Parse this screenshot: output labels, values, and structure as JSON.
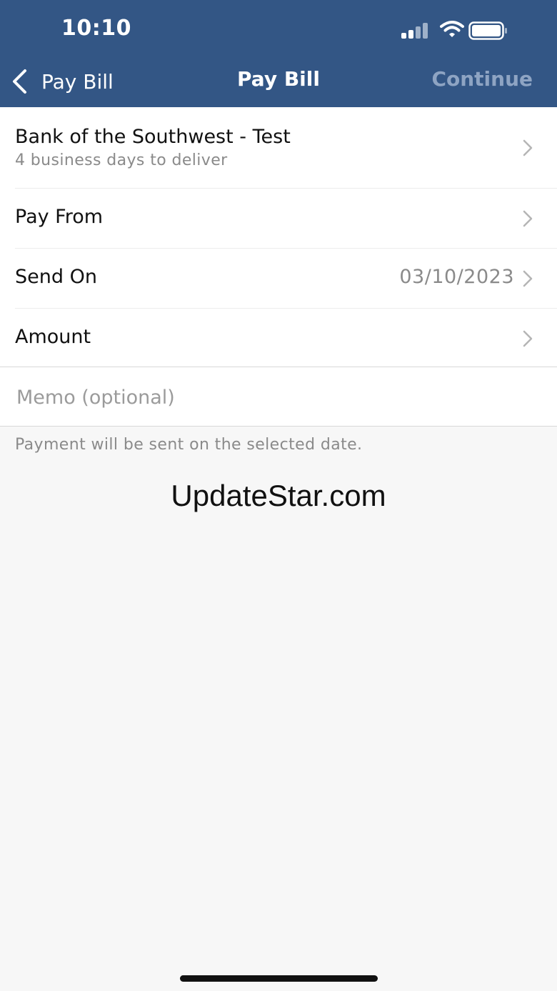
{
  "status_bar": {
    "time": "10:10",
    "icons": [
      "signal-icon",
      "wifi-icon",
      "battery-icon"
    ]
  },
  "nav": {
    "back_label": "Pay Bill",
    "title": "Pay Bill",
    "continue_label": "Continue"
  },
  "form": {
    "payee": {
      "name": "Bank of the Southwest - Test",
      "delivery": "4 business days to deliver"
    },
    "pay_from": {
      "label": "Pay From"
    },
    "send_on": {
      "label": "Send On",
      "value": "03/10/2023"
    },
    "amount": {
      "label": "Amount"
    },
    "memo": {
      "placeholder": "Memo (optional)",
      "value": ""
    }
  },
  "footnote": "Payment will be sent on the selected date.",
  "watermark": "UpdateStar.com",
  "colors": {
    "header": "#335685",
    "continue_disabled": "#8ea4c3",
    "background": "#f7f7f7"
  }
}
